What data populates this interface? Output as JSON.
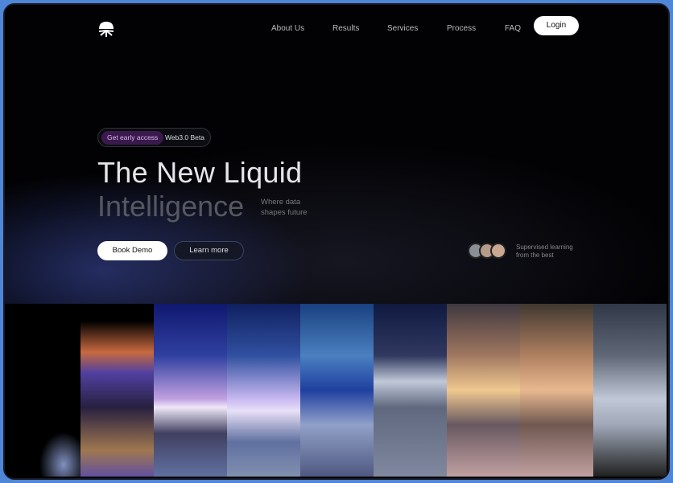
{
  "nav": {
    "items": [
      "About Us",
      "Results",
      "Services",
      "Process",
      "FAQ"
    ],
    "login": "Login"
  },
  "hero": {
    "badge": "Get early access",
    "badge_tag": "Web3.0 Beta",
    "title_line1": "The New Liquid",
    "title_line2": "Intelligence",
    "subtitle_line1": "Where data",
    "subtitle_line2": "shapes future",
    "book_demo": "Book Demo",
    "learn_more": "Learn more"
  },
  "social": {
    "line1": "Supervised learning",
    "line2": "from the best"
  },
  "colors": {
    "frame": "#4f86d8",
    "background": "#000000",
    "badge": "#3a1a4c"
  }
}
